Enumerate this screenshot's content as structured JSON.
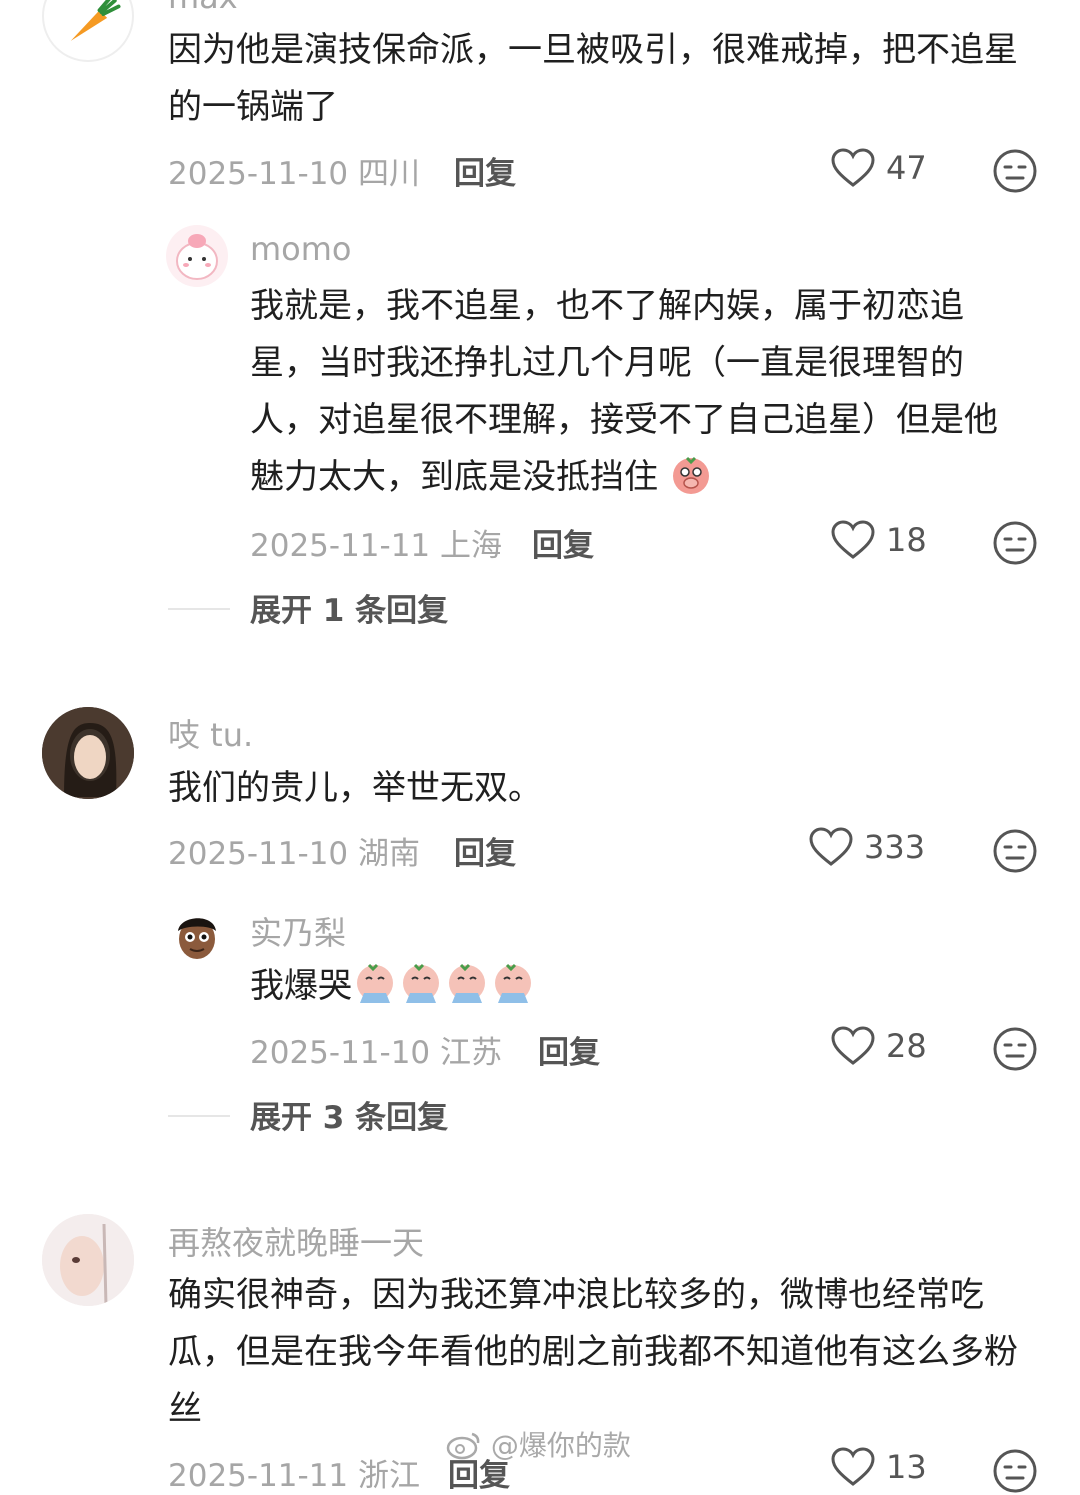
{
  "comments": [
    {
      "username": "max",
      "text": "因为他是演技保命派，一旦被吸引，很难戒掉，把不追星的一锅端了",
      "date": "2025-11-10",
      "location": "四川",
      "reply_label": "回复",
      "likes": "47",
      "avatar_icon": "carrot-icon"
    },
    {
      "username": "momo",
      "text": "我就是，我不追星，也不了解内娱，属于初恋追星，当时我还挣扎过几个月呢（一直是很理智的人，对追星很不理解，接受不了自己追星）但是他魅力太大，到底是没抵挡住",
      "date": "2025-11-11",
      "location": "上海",
      "reply_label": "回复",
      "likes": "18",
      "expand_label": "展开 1 条回复",
      "avatar_icon": "pink-bunny-icon"
    },
    {
      "username": "吱 tu.",
      "text": "我们的贵儿，举世无双。",
      "date": "2025-11-10",
      "location": "湖南",
      "reply_label": "回复",
      "likes": "333"
    },
    {
      "username": "实乃梨",
      "text": "我爆哭",
      "date": "2025-11-10",
      "location": "江苏",
      "reply_label": "回复",
      "likes": "28",
      "expand_label": "展开 3 条回复",
      "avatar_icon": "cartoon-boy-icon"
    },
    {
      "username": "再熬夜就晚睡一天",
      "text": "确实很神奇，因为我还算冲浪比较多的，微博也经常吃瓜，但是在我今年看他的剧之前我都不知道他有这么多粉丝",
      "date": "2025-11-11",
      "location": "浙江",
      "reply_label": "回复",
      "likes": "13"
    }
  ],
  "watermark": "@爆你的款",
  "colors": {
    "meta": "#a6a6a6",
    "text": "#1f1f1f",
    "icon": "#555555"
  }
}
